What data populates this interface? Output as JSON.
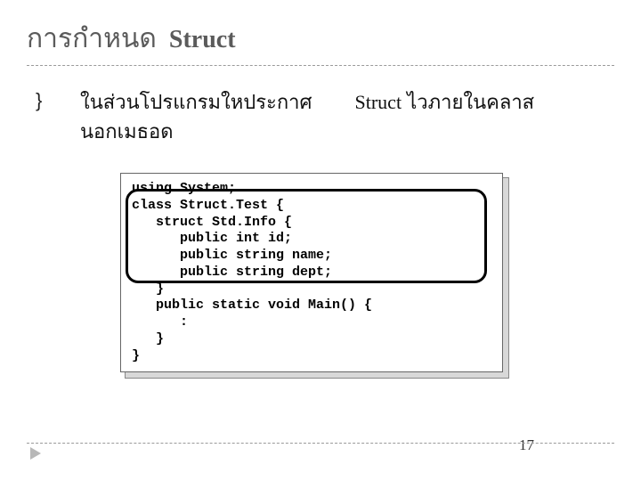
{
  "title": {
    "th": "การกำหนด",
    "en": "Struct"
  },
  "bullet": {
    "line1a": "ในส่วนโปรแกรมใหประกาศ",
    "line1b_en": "Struct",
    "line1b_th": "ไวภายในคลาส",
    "line2": "นอกเมธอด"
  },
  "code": {
    "l1": "using System;",
    "l2": "class Struct.Test {",
    "l3": "   struct Std.Info {",
    "l4": "      public int id;",
    "l5": "      public string name;",
    "l6": "      public string dept;",
    "l7": "   }",
    "l8": "   public static void Main() {",
    "l9": "      :",
    "l10": "   }",
    "l11": "}"
  },
  "pageNumber": "17"
}
